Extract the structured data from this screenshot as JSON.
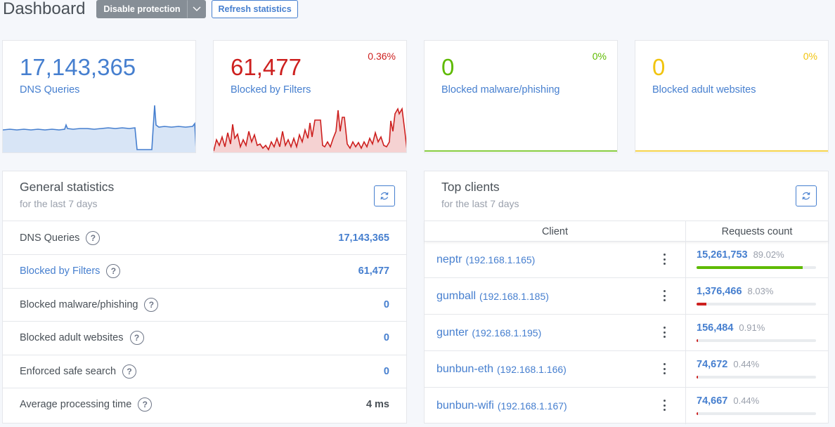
{
  "header": {
    "title": "Dashboard",
    "disable_protection": "Disable protection",
    "refresh_statistics": "Refresh statistics"
  },
  "colors": {
    "blue": "#467fcf",
    "red": "#cd201f",
    "green": "#5eba00",
    "yellow": "#f1c40f"
  },
  "stats": {
    "dns_queries": {
      "value": "17,143,365",
      "label": "DNS Queries"
    },
    "blocked_filters": {
      "value": "61,477",
      "label": "Blocked by Filters",
      "percent": "0.36%"
    },
    "blocked_malware": {
      "value": "0",
      "label": "Blocked malware/phishing",
      "percent": "0%"
    },
    "blocked_adult": {
      "value": "0",
      "label": "Blocked adult websites",
      "percent": "0%"
    }
  },
  "general_statistics": {
    "title": "General statistics",
    "subtitle": "for the last 7 days",
    "help_glyph": "?",
    "rows": [
      {
        "label": "DNS Queries",
        "value": "17,143,365"
      },
      {
        "label": "Blocked by Filters",
        "value": "61,477"
      },
      {
        "label": "Blocked malware/phishing",
        "value": "0"
      },
      {
        "label": "Blocked adult websites",
        "value": "0"
      },
      {
        "label": "Enforced safe search",
        "value": "0"
      },
      {
        "label": "Average processing time",
        "value": "4 ms"
      }
    ]
  },
  "top_clients": {
    "title": "Top clients",
    "subtitle": "for the last 7 days",
    "col_client": "Client",
    "col_requests": "Requests count",
    "rows": [
      {
        "name": "neptr",
        "ip": "(192.168.1.165)",
        "count": "15,261,753",
        "percent": "89.02%",
        "share": 0.8902,
        "bar_color": "#5eba00"
      },
      {
        "name": "gumball",
        "ip": "(192.168.1.185)",
        "count": "1,376,466",
        "percent": "8.03%",
        "share": 0.0803,
        "bar_color": "#cd201f"
      },
      {
        "name": "gunter",
        "ip": "(192.168.1.195)",
        "count": "156,484",
        "percent": "0.91%",
        "share": 0.0091,
        "bar_color": "#cd201f"
      },
      {
        "name": "bunbun-eth",
        "ip": "(192.168.1.166)",
        "count": "74,672",
        "percent": "0.44%",
        "share": 0.0044,
        "bar_color": "#cd201f"
      },
      {
        "name": "bunbun-wifi",
        "ip": "(192.168.1.167)",
        "count": "74,667",
        "percent": "0.44%",
        "share": 0.0044,
        "bar_color": "#cd201f"
      }
    ]
  }
}
